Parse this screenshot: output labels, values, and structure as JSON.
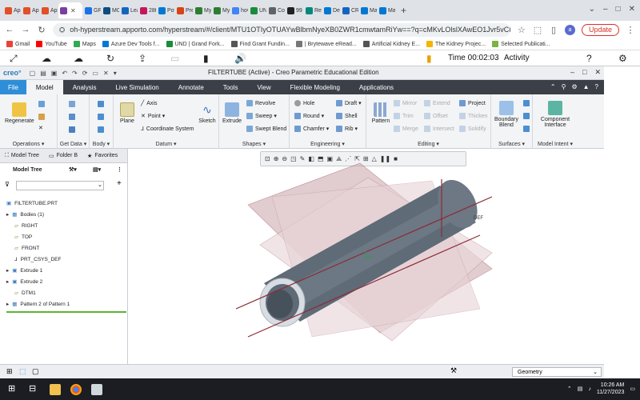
{
  "browser": {
    "tabs": [
      {
        "label": "App",
        "color": "#e34f26"
      },
      {
        "label": "App",
        "color": "#e34f26"
      },
      {
        "label": "App",
        "color": "#e34f26"
      },
      {
        "label": "",
        "color": "#7b3fa0",
        "active": true
      },
      {
        "label": "GPI",
        "color": "#1a73e8"
      },
      {
        "label": "MO",
        "color": "#0f4c81"
      },
      {
        "label": "Lea",
        "color": "#1565c0"
      },
      {
        "label": "28t",
        "color": "#c2185b"
      },
      {
        "label": "Pov",
        "color": "#0078d4"
      },
      {
        "label": "Pre",
        "color": "#d84315"
      },
      {
        "label": "My",
        "color": "#2e7d32"
      },
      {
        "label": "My",
        "color": "#2e7d32"
      },
      {
        "label": "hov",
        "color": "#4285f4"
      },
      {
        "label": "UNI",
        "color": "#1b8a3a"
      },
      {
        "label": "Cor",
        "color": "#5f6368"
      },
      {
        "label": "99",
        "color": "#222222"
      },
      {
        "label": "Rec",
        "color": "#00897b"
      },
      {
        "label": "Dec",
        "color": "#0078d4"
      },
      {
        "label": "CRI",
        "color": "#1565c0"
      },
      {
        "label": "Mai",
        "color": "#0078d4"
      },
      {
        "label": "Mai",
        "color": "#0078d4"
      }
    ],
    "url": "oh-hyperstream.apporto.com/hyperstream/#/client/MTU1OTIyOTUAYwBlbmNyeXB0ZWR1cmwtamRiYw==?q=cMKvLOlslXAwEO1Jvr5vCKbVj8pJ...",
    "avatar_letter": "a",
    "update_label": "Update",
    "bookmarks": [
      {
        "label": "Gmail",
        "color": "#ea4335"
      },
      {
        "label": "YouTube",
        "color": "#ff0000"
      },
      {
        "label": "Maps",
        "color": "#34a853"
      },
      {
        "label": "Azure Dev Tools f...",
        "color": "#0078d4"
      },
      {
        "label": "UND | Grand Fork...",
        "color": "#1b8a3a"
      },
      {
        "label": "Find Grant Fundin...",
        "color": "#555555"
      },
      {
        "label": "| Brytewave eRead...",
        "color": "#777777"
      },
      {
        "label": "Artificial Kidney E...",
        "color": "#555555"
      },
      {
        "label": "The Kidney Projec...",
        "color": "#f4b400"
      },
      {
        "label": "Selected Publicati...",
        "color": "#7cb342"
      }
    ]
  },
  "hyperstream": {
    "time": "Time 00:02:03",
    "activity": "Activity"
  },
  "creo": {
    "logo": "creo°",
    "window_title": "FILTERTUBE (Active) - Creo Parametric Educational Edition",
    "ribbon_tabs": [
      "File",
      "Model",
      "Analysis",
      "Live Simulation",
      "Annotate",
      "Tools",
      "View",
      "Flexible Modeling",
      "Applications"
    ],
    "groups": {
      "operations": "Operations ▾",
      "get_data": "Get Data ▾",
      "body": "Body ▾",
      "datum": "Datum ▾",
      "shapes": "Shapes ▾",
      "engineering": "Engineering ▾",
      "editing": "Editing ▾",
      "surfaces": "Surfaces ▾",
      "model_intent": "Model Intent ▾"
    },
    "buttons": {
      "regenerate": "Regenerate",
      "plane": "Plane",
      "axis": "Axis",
      "point": "Point ▾",
      "coordinate_system": "Coordinate System",
      "sketch": "Sketch",
      "extrude": "Extrude",
      "revolve": "Revolve",
      "sweep": "Sweep ▾",
      "swept_blend": "Swept Blend",
      "hole": "Hole",
      "round": "Round ▾",
      "chamfer": "Chamfer ▾",
      "draft": "Draft ▾",
      "shell": "Shell",
      "rib": "Rib ▾",
      "pattern": "Pattern",
      "mirror": "Mirror",
      "trim": "Trim",
      "merge": "Merge",
      "extend": "Extend",
      "offset": "Offset",
      "intersect": "Intersect",
      "project": "Project",
      "thicken": "Thicken",
      "solidify": "Solidify",
      "boundary_blend": "Boundary Blend",
      "component_interface": "Component Interface"
    },
    "panel_tabs": [
      "Model Tree",
      "Folder B",
      "Favorites"
    ],
    "tree_header": "Model Tree",
    "tree_items": [
      "FILTERTUBE.PRT",
      "Bodies (1)",
      "RIGHT",
      "TOP",
      "FRONT",
      "PRT_CSYS_DEF",
      "Extrude 1",
      "Extrude 2",
      "DTM1",
      "Pattern 2 of Pattern 1"
    ],
    "datum_label": "DEF",
    "filter_value": "Geometry"
  },
  "taskbar": {
    "time": "10:26 AM",
    "date": "11/27/2023"
  }
}
